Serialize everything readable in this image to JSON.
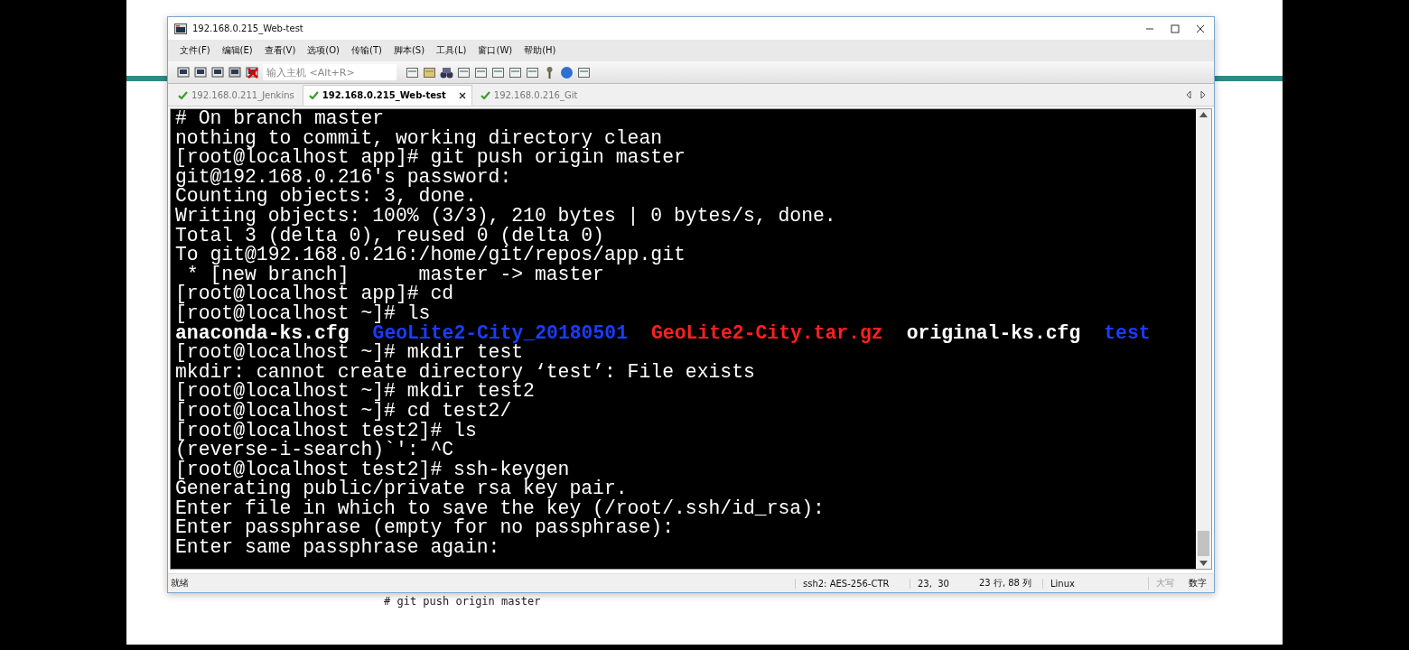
{
  "window": {
    "title": "192.168.0.215_Web-test"
  },
  "menu": [
    "文件(F)",
    "编辑(E)",
    "查看(V)",
    "选项(O)",
    "传输(T)",
    "脚本(S)",
    "工具(L)",
    "窗口(W)",
    "帮助(H)"
  ],
  "host_field": {
    "placeholder": "输入主机 <Alt+R>"
  },
  "tabs": [
    {
      "label": "192.168.0.211_Jenkins",
      "selected": false
    },
    {
      "label": "192.168.0.215_Web-test",
      "selected": true
    },
    {
      "label": "192.168.0.216_Git",
      "selected": false
    }
  ],
  "terminal_lines": [
    {
      "kind": "plain",
      "text": "# On branch master"
    },
    {
      "kind": "plain",
      "text": "nothing to commit, working directory clean"
    },
    {
      "kind": "plain",
      "text": "[root@localhost app]# git push origin master"
    },
    {
      "kind": "plain",
      "text": "git@192.168.0.216's password: "
    },
    {
      "kind": "plain",
      "text": "Counting objects: 3, done."
    },
    {
      "kind": "plain",
      "text": "Writing objects: 100% (3/3), 210 bytes | 0 bytes/s, done."
    },
    {
      "kind": "plain",
      "text": "Total 3 (delta 0), reused 0 (delta 0)"
    },
    {
      "kind": "plain",
      "text": "To git@192.168.0.216:/home/git/repos/app.git"
    },
    {
      "kind": "plain",
      "text": " * [new branch]      master -> master"
    },
    {
      "kind": "plain",
      "text": "[root@localhost app]# cd"
    },
    {
      "kind": "plain",
      "text": "[root@localhost ~]# ls"
    },
    {
      "kind": "listing",
      "entries": [
        {
          "text": "anaconda-ks.cfg",
          "color": "#ffffff"
        },
        {
          "text": "GeoLite2-City_20180501",
          "color": "#1a3cff"
        },
        {
          "text": "GeoLite2-City.tar.gz",
          "color": "#ff2020"
        },
        {
          "text": "original-ks.cfg",
          "color": "#ffffff"
        },
        {
          "text": "test",
          "color": "#1a3cff"
        }
      ]
    },
    {
      "kind": "plain",
      "text": "[root@localhost ~]# mkdir test"
    },
    {
      "kind": "plain",
      "text": "mkdir: cannot create directory ‘test’: File exists"
    },
    {
      "kind": "plain",
      "text": "[root@localhost ~]# mkdir test2"
    },
    {
      "kind": "plain",
      "text": "[root@localhost ~]# cd test2/"
    },
    {
      "kind": "plain",
      "text": "[root@localhost test2]# ls"
    },
    {
      "kind": "plain",
      "text": "(reverse-i-search)`': ^C"
    },
    {
      "kind": "plain",
      "text": "[root@localhost test2]# ssh-keygen"
    },
    {
      "kind": "plain",
      "text": "Generating public/private rsa key pair."
    },
    {
      "kind": "plain",
      "text": "Enter file in which to save the key (/root/.ssh/id_rsa): "
    },
    {
      "kind": "plain",
      "text": "Enter passphrase (empty for no passphrase): "
    },
    {
      "kind": "plain",
      "text": "Enter same passphrase again: "
    }
  ],
  "status_bar": {
    "state": "就绪",
    "cipher": "ssh2: AES-256-CTR",
    "cursor": "23,  30",
    "size": "23 行, 88 列",
    "os": "Linux",
    "caps": {
      "text": "大写",
      "on": false
    },
    "num": {
      "text": "数字",
      "on": true
    }
  },
  "slide_note": "# git push origin master"
}
